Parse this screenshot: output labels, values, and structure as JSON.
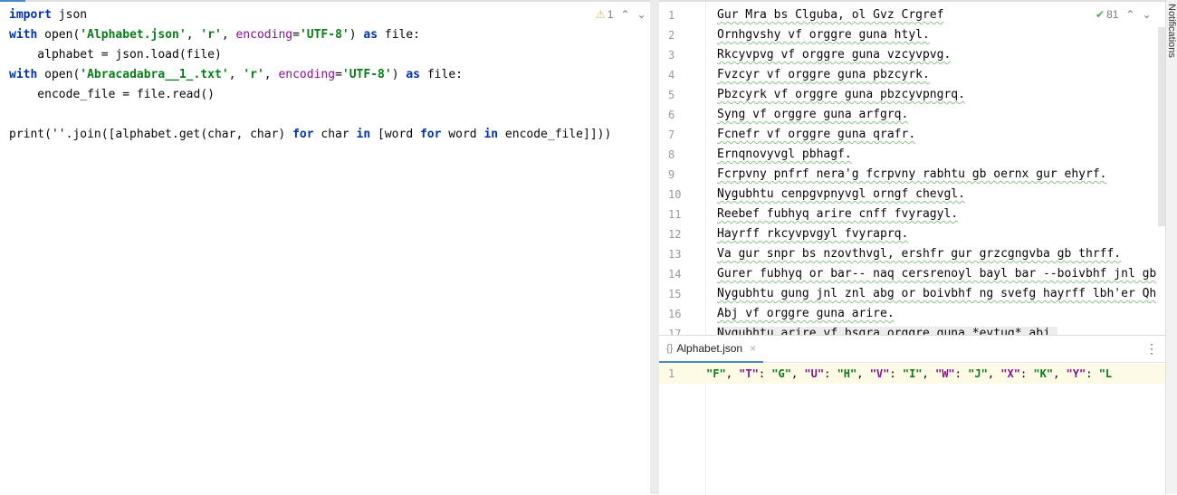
{
  "left_editor": {
    "inspection": {
      "warning_count": "1"
    },
    "lines": [
      [
        "import",
        " json"
      ],
      [
        "with",
        " open(",
        "'Alphabet.json'",
        ", ",
        "'r'",
        ", ",
        "encoding",
        "=",
        "'UTF-8'",
        ") ",
        "as",
        " file:"
      ],
      [
        "    alphabet = json.load(file)"
      ],
      [
        "with",
        " open(",
        "'Abracadabra__1_.txt'",
        ", ",
        "'r'",
        ", ",
        "encoding",
        "=",
        "'UTF-8'",
        ") ",
        "as",
        " file:"
      ],
      [
        "    encode_file = file.read()"
      ],
      [
        ""
      ],
      [
        "print(''.join([alphabet.get(char, char) ",
        "for",
        " char ",
        "in",
        " [word ",
        "for",
        " word ",
        "in",
        " encode_file]]))"
      ]
    ]
  },
  "right_editor": {
    "inspection": {
      "ok_count": "81"
    },
    "line_numbers": [
      "1",
      "2",
      "3",
      "4",
      "5",
      "6",
      "7",
      "8",
      "9",
      "10",
      "11",
      "12",
      "13",
      "14",
      "15",
      "16",
      "17"
    ],
    "lines": [
      "Gur Mra bs Clguba, ol Gvz Crgref",
      "Ornhgvshy vf orggre guna htyl.",
      "Rkcyvpvg vf orggre guna vzcyvpvg.",
      "Fvzcyr vf orggre guna pbzcyrk.",
      "Pbzcyrk vf orggre guna pbzcyvpngrq.",
      "Syng vf orggre guna arfgrq.",
      "Fcnefr vf orggre guna qrafr.",
      "Ernqnovyvgl pbhagf.",
      "Fcrpvny pnfrf nera'g fcrpvny rabhtu gb oernx gur ehyrf.",
      "Nygubhtu cenpgvpnyvgl orngf chevgl.",
      "Reebef fubhyq arire cnff fvyragyl.",
      "Hayrff rkcyvpvgyl fvyraprq.",
      "Va gur snpr bs nzovthvgl, ershfr gur grzcgngvba gb thrff.",
      "Gurer fubhyq or bar-- naq cersrenoyl bayl bar --boivbhf jnl gb",
      "Nygubhtu gung jnl znl abg or boivbhf ng svefg hayrff lbh'er Qh",
      "Abj vf orggre guna arire.",
      "Nygubhtu arire vf bsgra orggre guna *evtug* abj."
    ]
  },
  "bottom_panel": {
    "tab_label": "Alphabet.json",
    "line_number": "1",
    "tokens": [
      "\"F\"",
      ", ",
      "\"T\"",
      ": ",
      "\"G\"",
      ", ",
      "\"U\"",
      ": ",
      "\"H\"",
      ", ",
      "\"V\"",
      ": ",
      "\"I\"",
      ", ",
      "\"W\"",
      ": ",
      "\"J\"",
      ", ",
      "\"X\"",
      ": ",
      "\"K\"",
      ", ",
      "\"Y\"",
      ": ",
      "\"L"
    ]
  },
  "notifications": {
    "label": "Notifications"
  }
}
